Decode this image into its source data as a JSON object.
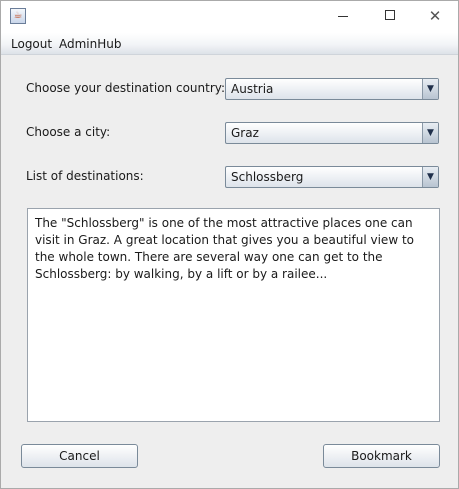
{
  "titlebar": {
    "icon": "java-coffee-icon",
    "controls": {
      "minimize": "minimize-icon",
      "maximize": "maximize-icon",
      "close_glyph": "✕"
    }
  },
  "menu": {
    "items": [
      "Logout",
      "AdminHub"
    ]
  },
  "form": {
    "country_label": "Choose your destination country:",
    "country_value": "Austria",
    "city_label": "Choose a city:",
    "city_value": "Graz",
    "destinations_label": "List of destinations:",
    "destinations_value": "Schlossberg",
    "dropdown_glyph": "▼"
  },
  "description": {
    "text": "The \"Schlossberg\" is one of the most attractive places one can visit in Graz. A great location that gives you a beautiful view to the whole town. There are several way one can get to the Schlossberg: by walking, by a lift or by a railee..."
  },
  "buttons": {
    "cancel": "Cancel",
    "bookmark": "Bookmark"
  },
  "colors": {
    "window_bg": "#eeeeee",
    "border": "#7a8a99",
    "arrow": "#1f2f4a"
  }
}
